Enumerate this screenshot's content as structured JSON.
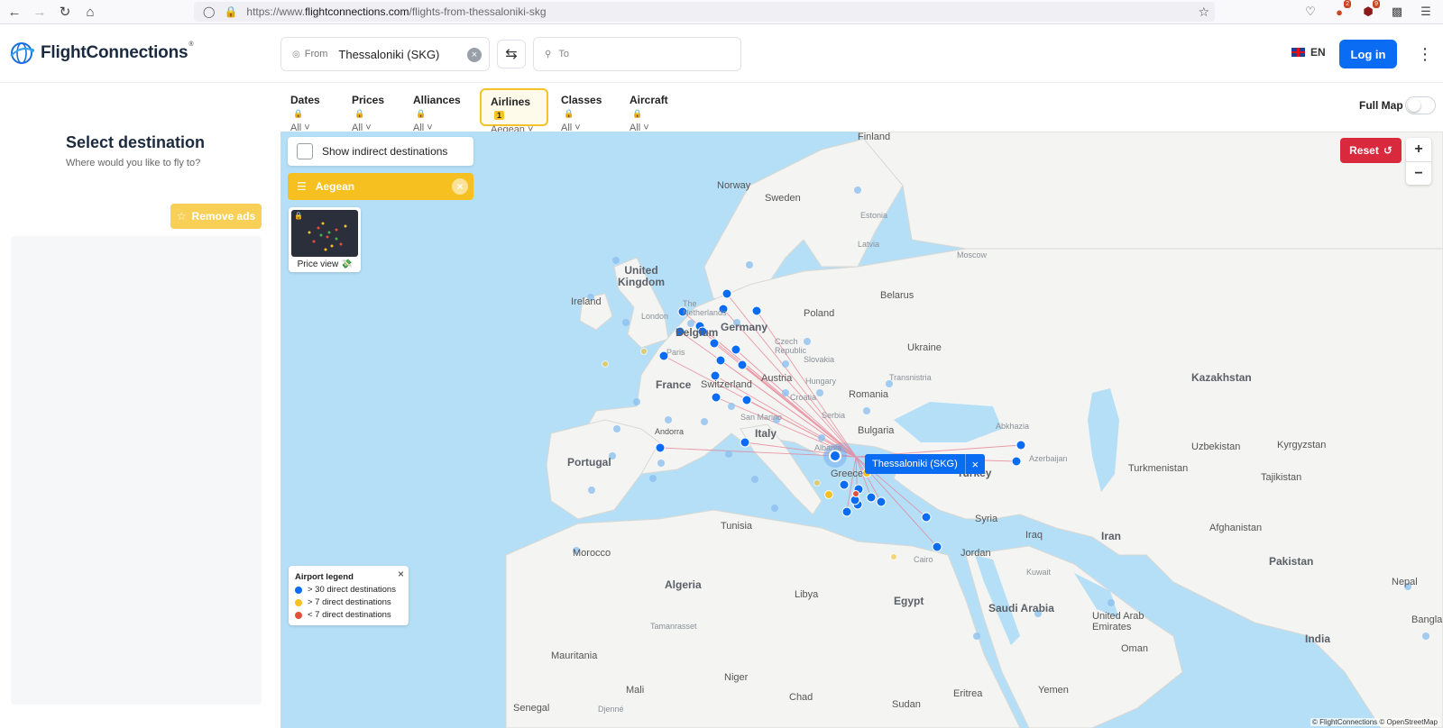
{
  "browser": {
    "url_prefix": "https://www.",
    "url_domain": "flightconnections.com",
    "url_path": "/flights-from-thessaloniki-skg",
    "badge_1": "2",
    "badge_2": "9"
  },
  "header": {
    "brand": "FlightConnections",
    "from_label": "From",
    "from_value": "Thessaloniki (SKG)",
    "to_placeholder": "To",
    "language": "EN",
    "login": "Log in"
  },
  "filters": [
    {
      "title": "Dates",
      "value": "All"
    },
    {
      "title": "Prices",
      "value": "All"
    },
    {
      "title": "Alliances",
      "value": "All"
    },
    {
      "title": "Airlines",
      "value": "Aegean",
      "count": "1"
    },
    {
      "title": "Classes",
      "value": "All"
    },
    {
      "title": "Aircraft",
      "value": "All"
    }
  ],
  "full_map_label": "Full Map",
  "sidebar": {
    "title": "Select destination",
    "subtitle": "Where would you like to fly to?",
    "remove_ads": "Remove ads"
  },
  "map": {
    "indirect_label": "Show indirect destinations",
    "airline_chip": "Aegean",
    "price_view": "Price view 💸",
    "reset": "Reset",
    "origin": "Thessaloniki (SKG)",
    "attribution": "© FlightConnections © OpenStreetMap",
    "legend": {
      "title": "Airport legend",
      "items": [
        {
          "label": "> 30 direct destinations",
          "color": "#0a6cf2"
        },
        {
          "label": "> 7 direct destinations",
          "color": "#f6c021"
        },
        {
          "label": "< 7 direct destinations",
          "color": "#e0503a"
        }
      ]
    },
    "labels": {
      "finland": "Finland",
      "norway": "Norway",
      "sweden": "Sweden",
      "estonia": "Estonia",
      "latvia": "Latvia",
      "moscow": "Moscow",
      "uk": "United Kingdom",
      "ireland": "Ireland",
      "london": "London",
      "netherlands": "The Netherlands",
      "belgium": "Belgium",
      "germany": "Germany",
      "poland": "Poland",
      "belarus": "Belarus",
      "ukraine": "Ukraine",
      "czech": "Czech Republic",
      "slovakia": "Slovakia",
      "austria": "Austria",
      "hungary": "Hungary",
      "switzerland": "Switzerland",
      "france": "France",
      "paris": "Paris",
      "croatia": "Croatia",
      "romania": "Romania",
      "transnistria": "Transnistria",
      "serbia": "Serbia",
      "san_marino": "San Marino",
      "italy": "Italy",
      "bulgaria": "Bulgaria",
      "andorra": "Andorra",
      "portugal": "Portugal",
      "albania": "Albania",
      "greece": "Greece",
      "turkey": "Turkey",
      "abkhazia": "Abkhazia",
      "azerbaijan": "Azerbaijan",
      "kazakhstan": "Kazakhstan",
      "uzbekistan": "Uzbekistan",
      "kyrgyzstan": "Kyrgyzstan",
      "turkmenistan": "Turkmenistan",
      "tajikistan": "Tajikistan",
      "syria": "Syria",
      "iraq": "Iraq",
      "iran": "Iran",
      "afghanistan": "Afghanistan",
      "pakistan": "Pakistan",
      "nepal": "Nepal",
      "tunisia": "Tunisia",
      "morocco": "Morocco",
      "algeria": "Algeria",
      "libya": "Libya",
      "egypt": "Egypt",
      "cairo": "Cairo",
      "jordan": "Jordan",
      "kuwait": "Kuwait",
      "saudi": "Saudi Arabia",
      "uae": "United Arab Emirates",
      "oman": "Oman",
      "india": "India",
      "bangla": "Bangla",
      "tamanrasset": "Tamanrasset",
      "mauritania": "Mauritania",
      "niger": "Niger",
      "mali": "Mali",
      "chad": "Chad",
      "sudan": "Sudan",
      "eritrea": "Eritrea",
      "yemen": "Yemen",
      "senegal": "Senegal",
      "djenne": "Djenné"
    }
  }
}
